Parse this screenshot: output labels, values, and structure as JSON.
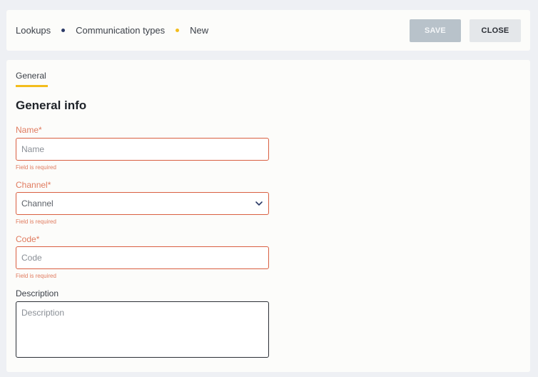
{
  "breadcrumb": {
    "items": [
      {
        "label": "Lookups",
        "dot_color": "#2b3a67"
      },
      {
        "label": "Communication types",
        "dot_color": "#f3bd1c"
      },
      {
        "label": "New"
      }
    ]
  },
  "toolbar": {
    "save_label": "SAVE",
    "close_label": "CLOSE"
  },
  "tabs": [
    {
      "label": "General",
      "active": true
    }
  ],
  "section": {
    "title": "General info"
  },
  "form": {
    "name": {
      "label": "Name*",
      "placeholder": "Name",
      "value": "",
      "error": "Field is required"
    },
    "channel": {
      "label": "Channel*",
      "selected": "Channel",
      "error": "Field is required"
    },
    "code": {
      "label": "Code*",
      "placeholder": "Code",
      "value": "",
      "error": "Field is required"
    },
    "description": {
      "label": "Description",
      "placeholder": "Description",
      "value": ""
    }
  },
  "colors": {
    "accent": "#f3bd1c",
    "error": "#d95f41",
    "save_disabled": "#b8c2ca"
  },
  "icons": {
    "channel_dropdown": "chevron-down-icon"
  }
}
